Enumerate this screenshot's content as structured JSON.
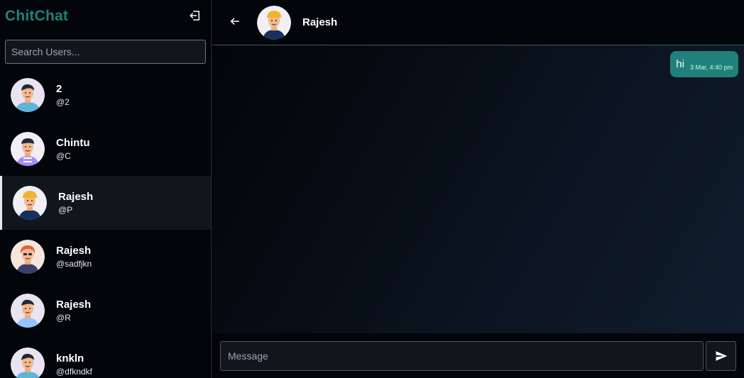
{
  "app": {
    "brand": "ChitChat",
    "brand_color": "#20807a",
    "logout_icon": "logout-icon"
  },
  "search": {
    "placeholder": "Search Users..."
  },
  "users": [
    {
      "name": "2",
      "handle": "@2",
      "avatar": "avatar-boy-blue-shirt"
    },
    {
      "name": "Chintu",
      "handle": "@C",
      "avatar": "avatar-boy-purple-stripes"
    },
    {
      "name": "Rajesh",
      "handle": "@P",
      "avatar": "avatar-boy-yellow-cap",
      "active": true
    },
    {
      "name": "Rajesh",
      "handle": "@sadfjkn",
      "avatar": "avatar-girl-red-hair"
    },
    {
      "name": "Rajesh",
      "handle": "@R",
      "avatar": "avatar-man-light-blue-shirt"
    },
    {
      "name": "knkln",
      "handle": "@dfkndkf",
      "avatar": "avatar-boy-blue-shirt"
    }
  ],
  "chat": {
    "title": "Rajesh",
    "back_icon": "arrow-left-icon",
    "messages": [
      {
        "text": "hi",
        "time": "3 Mar, 4:40 pm",
        "from_me": true
      }
    ],
    "input_placeholder": "Message",
    "send_icon": "send-icon"
  }
}
